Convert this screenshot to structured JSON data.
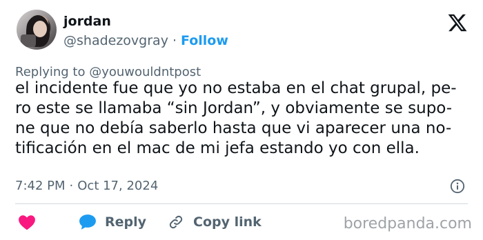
{
  "author": {
    "name": "jordan",
    "handle": "@shadezovgray",
    "separator": "·",
    "follow_label": "Follow"
  },
  "tweet": {
    "replying_to": "Replying to @youwouldntpost",
    "lines": [
      "el incidente fue que yo no estaba en el chat grupal, pe-",
      "ro este se llamaba “sin Jordan”, y obviamente se supo-",
      "ne que no debía saberlo hasta que vi aparecer una no-",
      "tificación en el mac de mi jefa estando yo con ella."
    ],
    "time": "7:42 PM",
    "date_separator": "·",
    "date": "Oct 17, 2024"
  },
  "actions": {
    "reply_label": "Reply",
    "copy_link_label": "Copy link"
  },
  "watermark": "boredpanda.com",
  "icons": {
    "logo": "x-logo-icon",
    "info": "info-icon",
    "like": "heart-icon",
    "reply": "speech-bubble-icon",
    "copy": "link-icon"
  },
  "colors": {
    "accent": "#1d9bf0",
    "heart": "#f91880",
    "text": "#0f1419",
    "muted": "#536471",
    "divider": "#cfd9de",
    "watermark": "#9ea3a7"
  }
}
